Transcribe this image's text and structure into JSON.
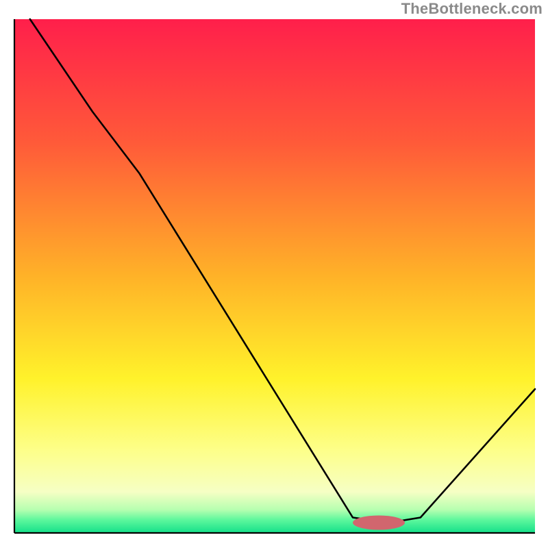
{
  "watermark": {
    "text": "TheBottleneck.com"
  },
  "chart_data": {
    "type": "line",
    "title": "",
    "xlabel": "",
    "ylabel": "",
    "xlim": [
      0,
      100
    ],
    "ylim": [
      0,
      100
    ],
    "background_gradient": {
      "stops": [
        {
          "offset": 0.0,
          "color": "#ff1f4b"
        },
        {
          "offset": 0.24,
          "color": "#ff5a39"
        },
        {
          "offset": 0.5,
          "color": "#ffb228"
        },
        {
          "offset": 0.7,
          "color": "#fff22b"
        },
        {
          "offset": 0.84,
          "color": "#fdff8a"
        },
        {
          "offset": 0.92,
          "color": "#f6ffc4"
        },
        {
          "offset": 0.955,
          "color": "#b6ffb0"
        },
        {
          "offset": 0.975,
          "color": "#5cf79c"
        },
        {
          "offset": 1.0,
          "color": "#14e08a"
        }
      ]
    },
    "series": [
      {
        "name": "bottleneck-curve",
        "color": "#000000",
        "x": [
          3,
          15,
          24,
          65,
          72,
          78,
          100
        ],
        "y": [
          100,
          82,
          70,
          3,
          2,
          3,
          28
        ]
      }
    ],
    "marker": {
      "name": "optimal-marker",
      "color": "#d1666e",
      "x": 70,
      "y": 2,
      "rx": 5,
      "ry": 1.4
    },
    "axes": {
      "show_border": true,
      "border_color": "#000000",
      "border_sides": [
        "left",
        "bottom"
      ]
    }
  }
}
